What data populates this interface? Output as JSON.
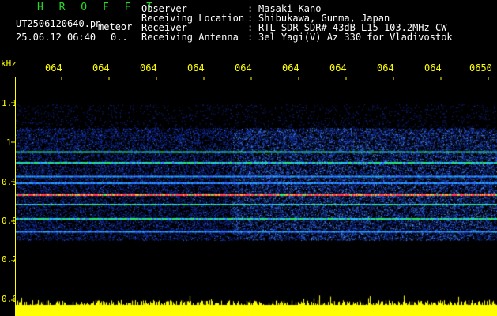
{
  "header": {
    "title": "H R O F F T",
    "filename": "UT2506120640.pn",
    "mode": "meteor",
    "datetime": "25.06.12 06:40",
    "zero_mark": "0..",
    "observer_label": "Observer",
    "observer_sep": ":",
    "observer_value": "Masaki Kano",
    "location_label": "Receiving Location",
    "location_sep": ":",
    "location_value": "Shibukawa, Gunma, Japan",
    "receiver_label": "Receiver",
    "receiver_sep": ":",
    "receiver_value": "RTL-SDR SDR# 43dB L15 103.2MHz CW",
    "antenna_label": "Receiving Antenna",
    "antenna_sep": ":",
    "antenna_value": "3el Yagi(V) Az 330 for Vladivostok"
  },
  "axes": {
    "y_unit": "kHz",
    "y_ticks": [
      "1.1",
      "1",
      "0.9",
      "0.8",
      "0.7",
      "0.6"
    ],
    "x_ticks": [
      "064",
      "064",
      "064",
      "064",
      "064",
      "064",
      "064",
      "064",
      "064",
      "0650"
    ]
  },
  "colors": {
    "background": "#000000",
    "axis_text": "#ffff00",
    "title_text": "#22dd22",
    "info_text": "#ffffff",
    "noise": "#1a3fd6",
    "trace_strong": "#ff3355",
    "trace_mid": "#22ee66",
    "noise_floor": "#ffff00"
  },
  "chart_data": {
    "type": "heatmap",
    "xlabel": "",
    "ylabel": "kHz",
    "ylim": [
      0.6,
      1.15
    ],
    "x_range_minutes": [
      0,
      10
    ],
    "signal_band_khz": [
      0.76,
      1.0
    ],
    "traces_khz": [
      {
        "freq": 0.975,
        "strength": "mid"
      },
      {
        "freq": 0.948,
        "strength": "mid"
      },
      {
        "freq": 0.913,
        "strength": "weak"
      },
      {
        "freq": 0.896,
        "strength": "weak"
      },
      {
        "freq": 0.868,
        "strength": "strong"
      },
      {
        "freq": 0.842,
        "strength": "mid"
      },
      {
        "freq": 0.806,
        "strength": "mid"
      },
      {
        "freq": 0.773,
        "strength": "weak"
      }
    ],
    "noise_floor_khz": 0.6
  }
}
